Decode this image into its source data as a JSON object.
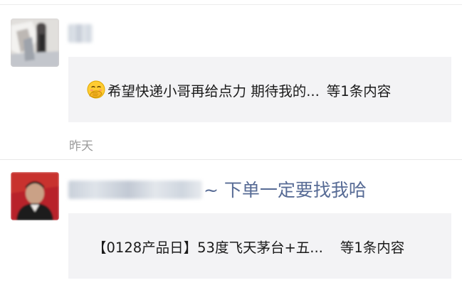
{
  "posts": [
    {
      "card_text": "希望快递小哥再给点力 期待我的...",
      "card_count": "等1条内容",
      "emoji_icon": "face-with-hand-over-mouth-icon",
      "time": "昨天"
    },
    {
      "name_visible": "~ 下单一定要找我哈",
      "card_text": "【0128产品日】53度飞天茅台+五...",
      "card_count": "等1条内容"
    }
  ],
  "colors": {
    "name_link": "#576b95",
    "card_bg": "#f3f3f5",
    "time_text": "#9b9b9b"
  }
}
